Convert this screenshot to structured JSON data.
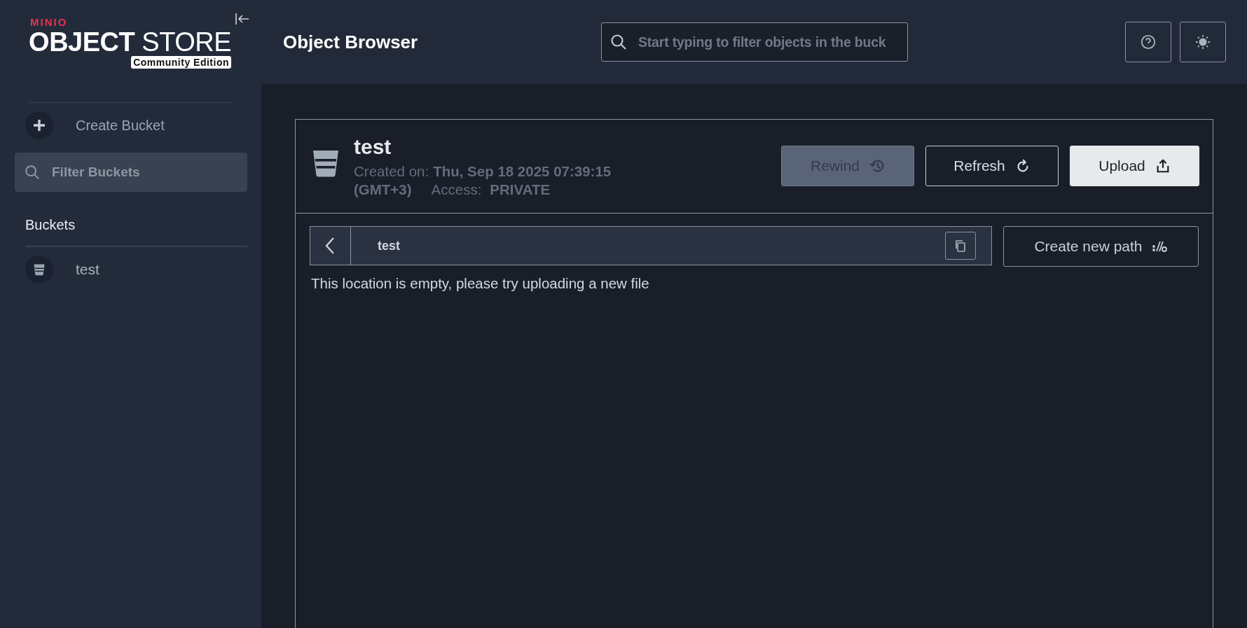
{
  "sidebar": {
    "logo": {
      "brand": "MINIO",
      "product_bold": "OBJECT",
      "product_light": "STORE",
      "edition": "Community Edition"
    },
    "create_bucket": "Create Bucket",
    "filter": {
      "placeholder": "Filter Buckets"
    },
    "section_title": "Buckets",
    "buckets": [
      {
        "name": "test"
      }
    ]
  },
  "header": {
    "title": "Object Browser",
    "search": {
      "placeholder": "Start typing to filter objects in the buck"
    }
  },
  "bucket": {
    "name": "test",
    "created_label": "Created on:",
    "created_value": "Thu, Sep 18 2025 07:39:15",
    "timezone": "(GMT+3)",
    "access_label": "Access:",
    "access_value": "PRIVATE",
    "buttons": [
      {
        "label": "Rewind",
        "kind": "rewind",
        "disabled": true
      },
      {
        "label": "Refresh",
        "kind": "refresh",
        "disabled": false
      },
      {
        "label": "Upload",
        "kind": "upload",
        "disabled": false
      }
    ]
  },
  "browser": {
    "path": "test",
    "create_path": "Create new path",
    "empty_message": "This location is empty, please try uploading a new file"
  }
}
